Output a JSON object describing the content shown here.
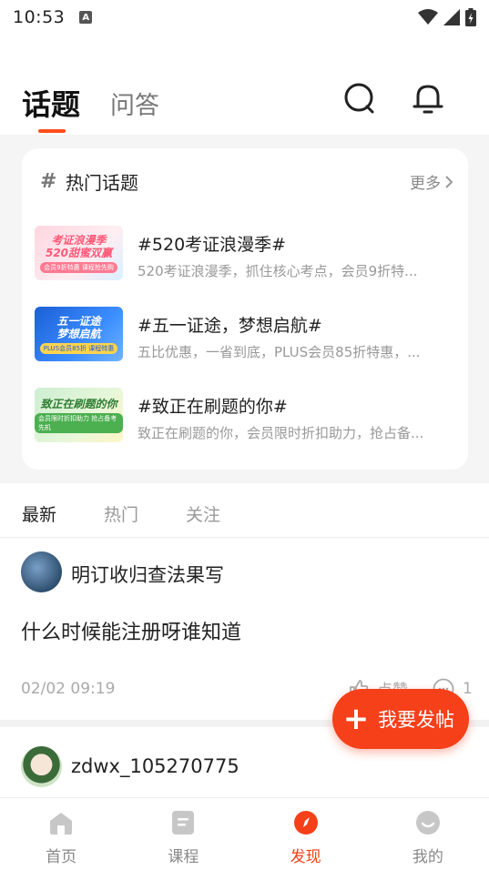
{
  "status_bar": {
    "time": "10:53",
    "a_badge": "A"
  },
  "header": {
    "tabs": [
      {
        "label": "话题",
        "active": true
      },
      {
        "label": "问答",
        "active": false
      }
    ],
    "search_icon": "search-icon",
    "bell_icon": "bell-icon"
  },
  "hot_topics": {
    "title": "热门话题",
    "more_label": "更多",
    "items": [
      {
        "title": "#520考证浪漫季#",
        "desc": "520考证浪漫季，抓住核心考点，会员9折特...",
        "thumb_lines": [
          "考证浪漫季",
          "520甜蜜双赢"
        ],
        "thumb_sub": "会员9折特惠 课程抢先购"
      },
      {
        "title": "#五一证途，梦想启航#",
        "desc": "五比优惠，一省到底，PLUS会员85折特惠，...",
        "thumb_lines": [
          "五一证途",
          "梦想启航"
        ],
        "thumb_sub": "PLUS会员85折 课程特惠"
      },
      {
        "title": "#致正在刷题的你#",
        "desc": "致正在刷题的你，会员限时折扣助力，抢占备...",
        "thumb_lines": [
          "致正在刷题的你"
        ],
        "thumb_sub": "会员限时折扣助力 抢占备考先机"
      }
    ]
  },
  "feed": {
    "tabs": [
      {
        "label": "最新",
        "active": true
      },
      {
        "label": "热门",
        "active": false
      },
      {
        "label": "关注",
        "active": false
      }
    ],
    "posts": [
      {
        "username": "明订收归查法果写",
        "content": "什么时候能注册呀谁知道",
        "time": "02/02 09:19",
        "like_label": "点赞",
        "comment_count": "1"
      },
      {
        "username": "zdwx_105270775"
      }
    ]
  },
  "fab": {
    "label": "我要发帖"
  },
  "bottom_nav": {
    "items": [
      {
        "label": "首页",
        "icon": "home-icon",
        "active": false
      },
      {
        "label": "课程",
        "icon": "course-icon",
        "active": false
      },
      {
        "label": "发现",
        "icon": "discover-icon",
        "active": true
      },
      {
        "label": "我的",
        "icon": "profile-icon",
        "active": false
      }
    ]
  },
  "colors": {
    "accent": "#f5401a",
    "text": "#222222",
    "muted": "#999999"
  }
}
